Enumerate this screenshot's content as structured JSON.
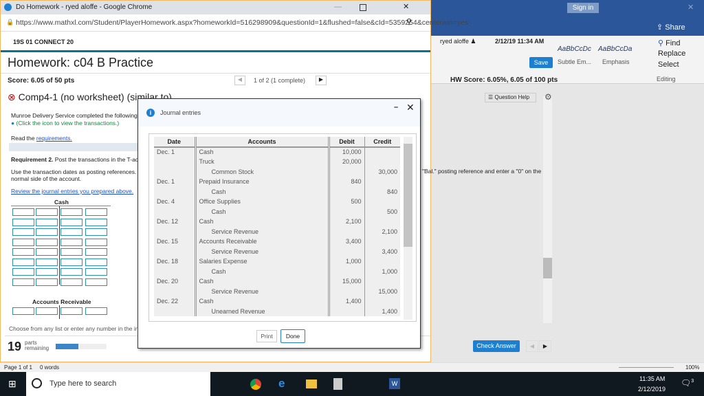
{
  "chrome": {
    "title": "Do Homework - ryed aloffe - Google Chrome",
    "url": "https://www.mathxl.com/Student/PlayerHomework.aspx?homeworkId=516298909&questionId=1&flushed=false&cId=5359254&centerwin=yes"
  },
  "header": {
    "course": "19S 01 CONNECT 20",
    "user": "ryed aloffe",
    "datetime": "2/12/19 11:34 AM",
    "homework_title": "Homework: c04 B Practice",
    "save": "Save",
    "score": "Score: 6.05 of 50 pts",
    "pager": "1 of 2 (1 complete)",
    "hw_score": "HW Score: 6.05%, 6.05 of 100 pts"
  },
  "question": {
    "title": "Comp4-1 (no worksheet) (similar to)",
    "help": "Question Help",
    "intro": "Munroe Delivery Service completed the following trans",
    "click_note": "(Click the icon to view the transactions.)",
    "read": "Read the",
    "requirements_link": "requirements.",
    "req2_bold": "Requirement 2.",
    "req2_text": "Post the transactions in the T-accou",
    "use_text": "Use the transaction dates as posting references. Use",
    "use_text_right": "\"Bal.\" posting reference and enter a \"0\" on the",
    "normal_side": "normal side of the account.",
    "review_link": "Review the journal entries you prepared above.",
    "t_cash": "Cash",
    "t_ar": "Accounts Receivable",
    "choose": "Choose from any list or enter any number in the inpu",
    "parts_num": "19",
    "parts_label": "parts remaining",
    "parts_progress": 0.45,
    "check": "Check Answer"
  },
  "modal": {
    "title": "Journal entries",
    "print": "Print",
    "done": "Done",
    "columns": [
      "Date",
      "Accounts",
      "Debit",
      "Credit"
    ],
    "rows": [
      [
        "Dec. 1",
        "Cash",
        "10,000",
        ""
      ],
      [
        "",
        "Truck",
        "20,000",
        ""
      ],
      [
        "",
        "Common Stock",
        "",
        "30,000"
      ],
      [
        "Dec. 1",
        "Prepaid Insurance",
        "840",
        ""
      ],
      [
        "",
        "Cash",
        "",
        "840"
      ],
      [
        "Dec. 4",
        "Office Supplies",
        "500",
        ""
      ],
      [
        "",
        "Cash",
        "",
        "500"
      ],
      [
        "Dec. 12",
        "Cash",
        "2,100",
        ""
      ],
      [
        "",
        "Service Revenue",
        "",
        "2,100"
      ],
      [
        "Dec. 15",
        "Accounts Receivable",
        "3,400",
        ""
      ],
      [
        "",
        "Service Revenue",
        "",
        "3,400"
      ],
      [
        "Dec. 18",
        "Salaries Expense",
        "1,000",
        ""
      ],
      [
        "",
        "Cash",
        "",
        "1,000"
      ],
      [
        "Dec. 20",
        "Cash",
        "15,000",
        ""
      ],
      [
        "",
        "Service Revenue",
        "",
        "15,000"
      ],
      [
        "Dec. 22",
        "Cash",
        "1,400",
        ""
      ],
      [
        "",
        "Unearned Revenue",
        "",
        "1,400"
      ]
    ]
  },
  "word": {
    "sign_in": "Sign in",
    "share": "Share",
    "style1": "AaBbCcDc",
    "style2": "AaBbCcDa",
    "style1_name": "Subtle Em...",
    "style2_name": "Emphasis",
    "find": "Find",
    "replace": "Replace",
    "select": "Select",
    "editing": "Editing",
    "page": "Page 1 of 1",
    "words": "0 words",
    "zoom": "100%"
  },
  "taskbar": {
    "search": "Type here to search",
    "time": "11:35 AM",
    "date": "2/12/2019",
    "notifications": "3"
  }
}
